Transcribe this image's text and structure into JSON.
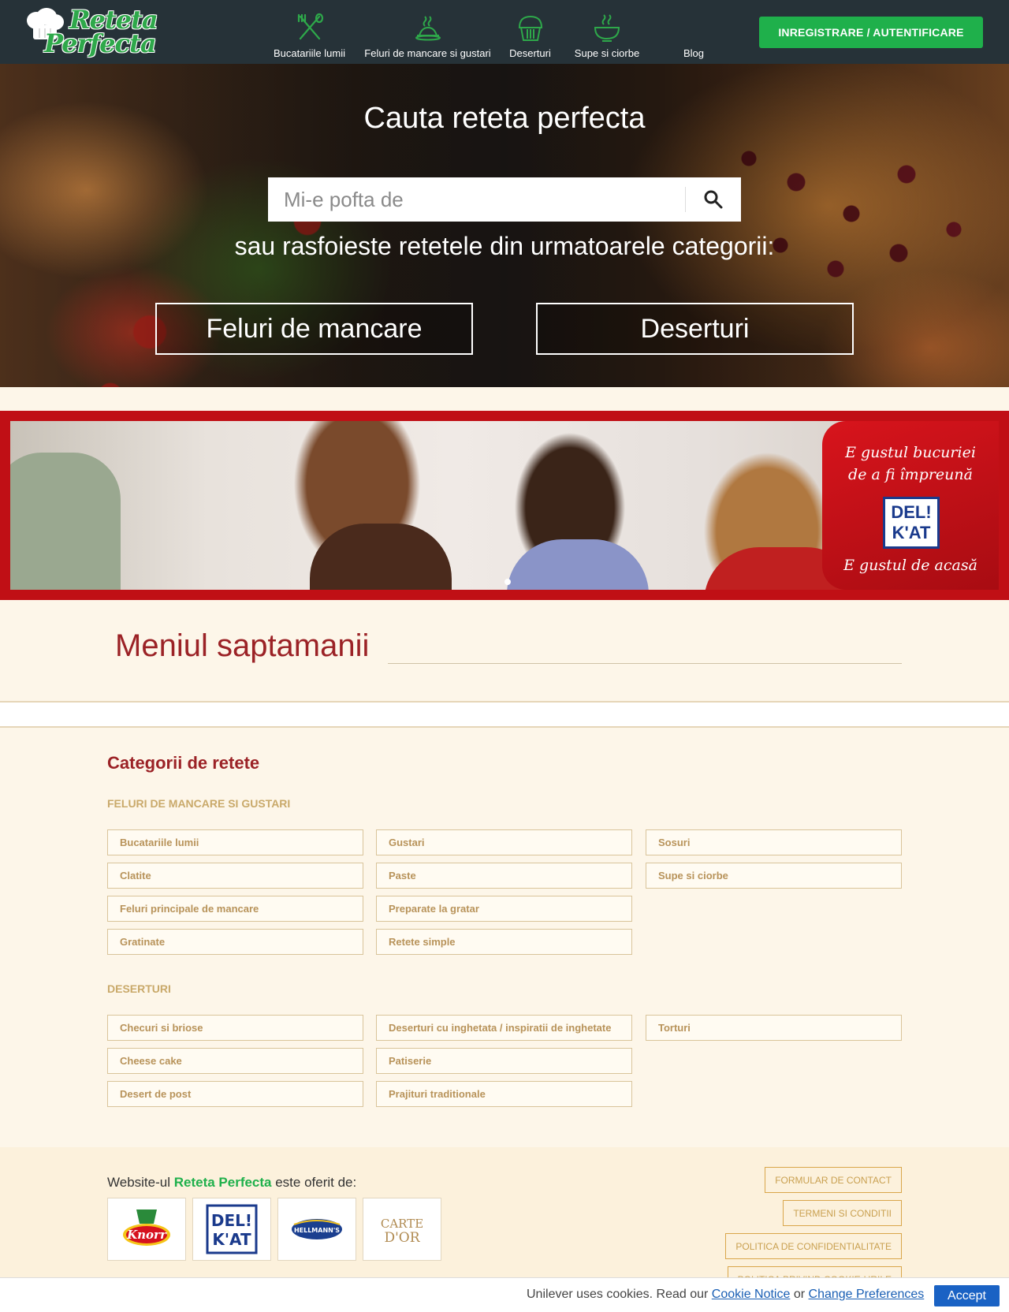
{
  "header": {
    "logo_line1": "Reteta",
    "logo_line2": "Perfecta",
    "nav": [
      {
        "label": "Bucatariile lumii",
        "icon": "utensils-icon"
      },
      {
        "label": "Feluri de mancare si gustari",
        "icon": "dish-icon"
      },
      {
        "label": "Deserturi",
        "icon": "muffin-icon"
      },
      {
        "label": "Supe si ciorbe",
        "icon": "soup-bowl-icon"
      },
      {
        "label": "Blog",
        "icon": ""
      }
    ],
    "login_label": "INREGISTRARE / AUTENTIFICARE"
  },
  "hero": {
    "title": "Cauta reteta perfecta",
    "search_placeholder": "Mi-e pofta de",
    "subtitle": "sau rasfoieste retetele din urmatoarele categorii:",
    "buttons": [
      "Feluri de mancare",
      "Deserturi"
    ]
  },
  "banner": {
    "slogan_top": "E gustul bucuriei\nde a fi împreună",
    "logo_line1": "DEL!",
    "logo_line2": "K'AT",
    "slogan_bottom": "E gustul de acasă"
  },
  "menu": {
    "title": "Meniul saptamanii"
  },
  "categories": {
    "title": "Categorii de retete",
    "groups": [
      {
        "title": "FELURI DE MANCARE SI GUSTARI",
        "columns": [
          [
            "Bucatariile lumii",
            "Clatite",
            "Feluri principale de mancare",
            "Gratinate"
          ],
          [
            "Gustari",
            "Paste",
            "Preparate la gratar",
            "Retete simple"
          ],
          [
            "Sosuri",
            "Supe si ciorbe"
          ]
        ]
      },
      {
        "title": "DESERTURI",
        "columns": [
          [
            "Checuri si briose",
            "Cheese cake",
            "Desert de post"
          ],
          [
            "Deserturi cu inghetata / inspiratii de inghetate",
            "Patiserie",
            "Prajituri traditionale"
          ],
          [
            "Torturi"
          ]
        ]
      }
    ]
  },
  "footer": {
    "offered_prefix": "Website-ul ",
    "offered_brand": "Reteta Perfecta",
    "offered_suffix": " este oferit de:",
    "brands": [
      "Knorr",
      "DEL!",
      "K'AT",
      "HELLMANN'S",
      "CARTE",
      "D'OR"
    ],
    "links": [
      "FORMULAR DE CONTACT",
      "TERMENI SI CONDITII",
      "POLITICA DE CONFIDENTIALITATE",
      "POLITICA PRIVIND COOKIE-URILE"
    ]
  },
  "cookie": {
    "text_prefix": "Unilever uses cookies. Read our ",
    "notice_link": "Cookie Notice",
    "text_middle": " or ",
    "prefs_link": "Change Preferences",
    "accept_label": "Accept"
  },
  "colors": {
    "header_bg": "#263238",
    "accent_green": "#1fb04b",
    "title_red": "#9b2226",
    "banner_red": "#c00f15",
    "category_text": "#b8935a",
    "page_bg": "#fdf6e9"
  }
}
